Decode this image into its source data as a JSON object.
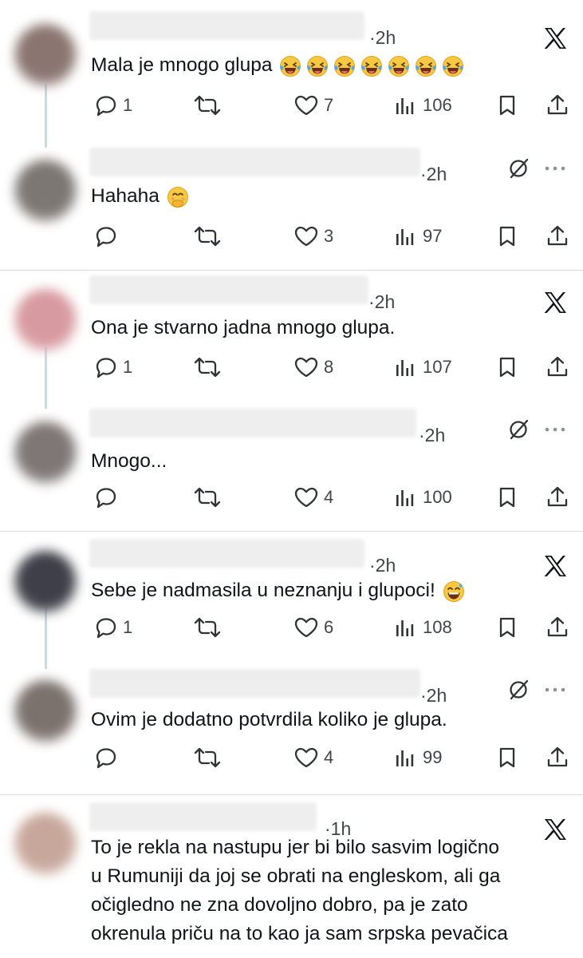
{
  "comments": [
    {
      "time": "·2h",
      "text": "Mala je mnogo glupa",
      "badge": "x",
      "emoji_count": 7,
      "emoji": "laughing-tears",
      "replies": "1",
      "likes": "7",
      "views": "106"
    },
    {
      "time": "·2h",
      "text": "Hahaha",
      "badge": "mute",
      "emoji_count": 1,
      "emoji": "hand-over-mouth",
      "replies": "",
      "likes": "3",
      "views": "97"
    },
    {
      "time": "·2h",
      "text": "Ona je stvarno jadna mnogo glupa.",
      "badge": "x",
      "emoji_count": 0,
      "replies": "1",
      "likes": "8",
      "views": "107"
    },
    {
      "time": "·2h",
      "text": "Mnogo...",
      "badge": "mute",
      "emoji_count": 0,
      "replies": "",
      "likes": "4",
      "views": "100"
    },
    {
      "time": "·2h",
      "text": "Sebe je nadmasila u neznanju i glupoci!",
      "badge": "x",
      "emoji_count": 1,
      "emoji": "sweat-smile",
      "replies": "1",
      "likes": "6",
      "views": "108"
    },
    {
      "time": "·2h",
      "text": "Ovim je dodatno potvrdila koliko je glupa.",
      "badge": "mute",
      "emoji_count": 0,
      "replies": "",
      "likes": "4",
      "views": "99"
    },
    {
      "time": "·1h",
      "badge": "x",
      "lines": [
        "To je rekla na nastupu jer bi bilo sasvim logično",
        "u Rumuniji da joj se obrati na engleskom, ali ga",
        "očigledno ne zna dovoljno dobro, pa je zato",
        "okrenula priču na to kao ja sam srpska pevačica"
      ]
    }
  ],
  "icons": {
    "reply": "reply-icon",
    "retweet": "retweet-icon",
    "like": "like-icon",
    "views": "views-icon",
    "bookmark": "bookmark-icon",
    "share": "share-icon",
    "x": "x-logo-icon",
    "mute": "mute-icon",
    "more": "more-icon"
  },
  "colors": {
    "text": "#0f1419",
    "secondary": "#40454a",
    "divider": "#dcdcdc",
    "thread": "#cfd9de"
  }
}
